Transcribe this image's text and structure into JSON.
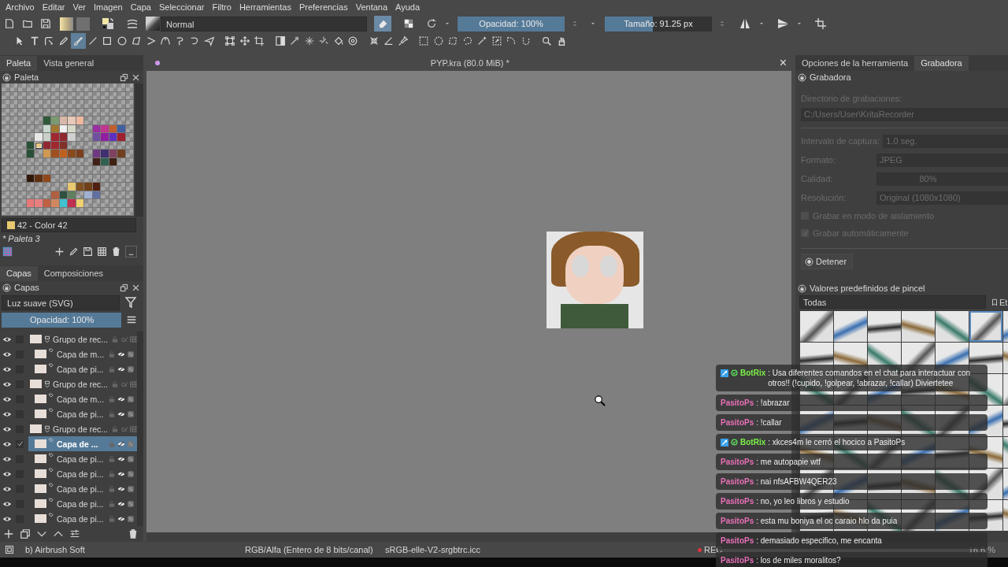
{
  "menu": [
    "Archivo",
    "Editar",
    "Ver",
    "Imagen",
    "Capa",
    "Seleccionar",
    "Filtro",
    "Herramientas",
    "Preferencias",
    "Ventana",
    "Ayuda"
  ],
  "toolbar": {
    "blend_mode": "Normal",
    "eraser_on": true,
    "opacity": {
      "label": "Opacidad: 100%",
      "level": 1
    },
    "size": {
      "label": "Tamaño: 91.25 px",
      "level": 0.45
    }
  },
  "tool_groups": [
    [
      {
        "selected": false
      },
      {
        "selected": false
      },
      {
        "selected": false
      },
      {
        "selected": false
      },
      {
        "selected": true
      },
      {
        "selected": false
      },
      {
        "selected": false
      },
      {
        "selected": false
      },
      {
        "selected": false
      },
      {
        "selected": false
      },
      {
        "selected": false
      },
      {
        "selected": false
      },
      {
        "selected": false
      },
      {
        "selected": false
      }
    ],
    [
      {
        "selected": false
      },
      {
        "selected": false
      },
      {
        "selected": false
      }
    ],
    [
      {
        "selected": false
      },
      {
        "selected": false
      },
      {
        "selected": false
      },
      {
        "selected": false
      },
      {
        "selected": false
      },
      {
        "selected": false
      }
    ],
    [
      {
        "selected": false
      },
      {
        "selected": false
      },
      {
        "selected": false
      }
    ],
    [
      {
        "selected": false
      },
      {
        "selected": false
      },
      {
        "selected": false
      },
      {
        "selected": false
      },
      {
        "selected": false
      },
      {
        "selected": false
      },
      {
        "selected": false
      },
      {
        "selected": false
      }
    ],
    [
      {
        "selected": false
      },
      {
        "selected": false
      }
    ]
  ],
  "left_dock": {
    "tabs": [
      {
        "label": "Paleta",
        "selected": true
      },
      {
        "label": "Vista general",
        "selected": false
      }
    ],
    "title": "Paleta",
    "palette": {
      "rows": [
        [
          null,
          null,
          null,
          null,
          null,
          null,
          null,
          null,
          null,
          null,
          null,
          null,
          null,
          null,
          null,
          null
        ],
        [
          null,
          null,
          null,
          null,
          null,
          null,
          null,
          null,
          null,
          null,
          null,
          null,
          null,
          null,
          null,
          null
        ],
        [
          null,
          null,
          null,
          null,
          null,
          null,
          null,
          null,
          null,
          null,
          null,
          null,
          null,
          null,
          null,
          null
        ],
        [
          null,
          null,
          null,
          null,
          null,
          null,
          null,
          null,
          null,
          null,
          null,
          null,
          null,
          null,
          null,
          null
        ],
        [
          null,
          null,
          null,
          null,
          null,
          {
            "color": "#2f5a3a",
            "selected": false
          },
          {
            "color": "#7a9a70",
            "selected": false
          },
          {
            "color": "#d8b8a8",
            "selected": false
          },
          {
            "color": "#e8c8b8",
            "selected": false
          },
          {
            "color": "#f0b8a0",
            "selected": false
          },
          null,
          null,
          null,
          null,
          null,
          null
        ],
        [
          null,
          null,
          null,
          null,
          null,
          {
            "color": "#c8d8d0",
            "selected": false
          },
          {
            "color": "#a07830",
            "selected": false
          },
          {
            "color": "#f0f0f0",
            "selected": false
          },
          {
            "color": "#d8d8c8",
            "selected": false
          },
          null,
          null,
          {
            "color": "#9a30a0",
            "selected": false
          },
          {
            "color": "#c03890",
            "selected": false
          },
          {
            "color": "#c06030",
            "selected": false
          },
          {
            "color": "#4060a0",
            "selected": false
          },
          null
        ],
        [
          null,
          null,
          null,
          null,
          {
            "color": "#e8e8e8",
            "selected": false
          },
          {
            "color": "#c8d0c8",
            "selected": false
          },
          {
            "color": "#a02830",
            "selected": false
          },
          {
            "color": "#902830",
            "selected": false
          },
          {
            "color": "#d0d0d0",
            "selected": false
          },
          null,
          null,
          {
            "color": "#7050a0",
            "selected": false
          },
          {
            "color": "#9020a0",
            "selected": false
          },
          {
            "color": "#6030c0",
            "selected": false
          },
          {
            "color": "#a02030",
            "selected": false
          },
          null
        ],
        [
          null,
          null,
          null,
          {
            "color": "#2a5038",
            "selected": false
          },
          {
            "color": "#e8c880",
            "selected": true
          },
          {
            "color": "#902830",
            "selected": false
          },
          {
            "color": "#a02830",
            "selected": false
          },
          {
            "color": "#803028",
            "selected": false
          },
          null,
          null,
          null,
          null,
          null,
          null,
          null,
          null
        ],
        [
          null,
          null,
          null,
          {
            "color": "#2a5038",
            "selected": false
          },
          null,
          {
            "color": "#d09850",
            "selected": false
          },
          {
            "color": "#a05020",
            "selected": false
          },
          {
            "color": "#c06020",
            "selected": false
          },
          {
            "color": "#8a4a20",
            "selected": false
          },
          {
            "color": "#7a4020",
            "selected": false
          },
          null,
          {
            "color": "#703880",
            "selected": false
          },
          {
            "color": "#403070",
            "selected": false
          },
          {
            "color": "#804060",
            "selected": false
          },
          {
            "color": "#704020",
            "selected": false
          },
          null
        ],
        [
          null,
          null,
          null,
          null,
          null,
          null,
          null,
          null,
          null,
          null,
          null,
          {
            "color": "#402018",
            "selected": false
          },
          {
            "color": "#306050",
            "selected": false
          },
          {
            "color": "#402010",
            "selected": false
          },
          null,
          null
        ],
        [
          null,
          null,
          null,
          null,
          null,
          null,
          null,
          null,
          null,
          null,
          null,
          null,
          null,
          null,
          null,
          null
        ],
        [
          null,
          null,
          null,
          {
            "color": "#301808",
            "selected": false
          },
          {
            "color": "#603010",
            "selected": false
          },
          {
            "color": "#904818",
            "selected": false
          },
          null,
          null,
          null,
          null,
          null,
          null,
          null,
          null,
          null,
          null
        ],
        [
          null,
          null,
          null,
          null,
          null,
          null,
          null,
          null,
          {
            "color": "#e8c870",
            "selected": false
          },
          {
            "color": "#805020",
            "selected": false
          },
          {
            "color": "#704018",
            "selected": false
          },
          {
            "color": "#502010",
            "selected": false
          },
          null,
          null,
          null,
          null
        ],
        [
          null,
          null,
          null,
          null,
          null,
          null,
          {
            "color": "#b06040",
            "selected": false
          },
          {
            "color": "#305040",
            "selected": false
          },
          {
            "color": "#608060",
            "selected": false
          },
          null,
          {
            "color": "#a0b0d0",
            "selected": false
          },
          {
            "color": "#6070a0",
            "selected": false
          },
          null,
          null,
          null,
          null
        ],
        [
          null,
          null,
          null,
          {
            "color": "#e87878",
            "selected": false
          },
          {
            "color": "#e88080",
            "selected": false
          },
          {
            "color": "#c06040",
            "selected": false
          },
          {
            "color": "#d08860",
            "selected": false
          },
          {
            "color": "#40c0d0",
            "selected": false
          },
          {
            "color": "#c03050",
            "selected": false
          },
          {
            "color": "#f0d070",
            "selected": false
          },
          null,
          null,
          null,
          null,
          null,
          null
        ],
        [
          null,
          null,
          null,
          null,
          null,
          null,
          null,
          null,
          null,
          null,
          null,
          null,
          null,
          null,
          null,
          null
        ]
      ],
      "current_color": {
        "label": "42 - Color 42",
        "color": "#e8c870"
      },
      "name": "* Paleta 3"
    },
    "layer_tabs": [
      {
        "label": "Capas",
        "selected": true
      },
      {
        "label": "Composiciones",
        "selected": false
      }
    ],
    "layers_title": "Capas",
    "layer_blend": "Luz suave (SVG)",
    "layer_opacity": {
      "label": "Opacidad:  100%",
      "level": 1
    },
    "layers": [
      {
        "name": "Grupo de rec...",
        "kind": "group",
        "visible": true,
        "checked": false,
        "selected": false,
        "children": [
          {
            "name": "Capa de m...",
            "kind": "layer",
            "visible": true,
            "checked": false,
            "selected": false
          },
          {
            "name": "Capa de pi...",
            "kind": "layer",
            "visible": true,
            "checked": false,
            "selected": false
          }
        ]
      },
      {
        "name": "Grupo de rec...",
        "kind": "group",
        "visible": true,
        "checked": false,
        "selected": false,
        "children": [
          {
            "name": "Capa de m...",
            "kind": "layer",
            "visible": true,
            "checked": false,
            "selected": false
          },
          {
            "name": "Capa de pi...",
            "kind": "layer",
            "visible": true,
            "checked": false,
            "selected": false
          }
        ]
      },
      {
        "name": "Grupo de rec...",
        "kind": "group",
        "visible": true,
        "checked": false,
        "selected": false,
        "children": [
          {
            "name": "Capa de ...",
            "kind": "layer",
            "visible": true,
            "checked": true,
            "selected": true
          },
          {
            "name": "Capa de pi...",
            "kind": "layer",
            "visible": true,
            "checked": false,
            "selected": false
          },
          {
            "name": "Capa de pi...",
            "kind": "layer",
            "visible": true,
            "checked": false,
            "selected": false
          },
          {
            "name": "Capa de pi...",
            "kind": "layer",
            "visible": true,
            "checked": false,
            "selected": false
          },
          {
            "name": "Capa de pi...",
            "kind": "layer",
            "visible": true,
            "checked": false,
            "selected": false
          },
          {
            "name": "Capa de pi...",
            "kind": "layer",
            "visible": true,
            "checked": false,
            "selected": false
          }
        ]
      }
    ]
  },
  "document": {
    "title": "PYP.kra (80.0 MiB) *",
    "close": "×"
  },
  "right_dock": {
    "tabs": [
      {
        "label": "Opciones de la herramienta",
        "selected": false
      },
      {
        "label": "Grabadora",
        "selected": true
      }
    ],
    "recorder": {
      "title": "Grabadora",
      "disabled": true,
      "directory_label": "Directorio de grabaciones:",
      "directory": "C:/Users/User\\KritaRecorder",
      "fields": [
        {
          "label": "Intervalo de captura:",
          "value": "1.0 seg.",
          "kind": "spin"
        },
        {
          "label": "Formato:",
          "value": "JPEG",
          "kind": "combo"
        },
        {
          "label": "Calidad:",
          "value": "80%",
          "kind": "slider"
        },
        {
          "label": "Resolución:",
          "value": "Original (1080x1080)",
          "kind": "combo"
        }
      ],
      "options": [
        {
          "label": "Grabar en modo de aislamiento",
          "checked": false
        },
        {
          "label": "Grabar automáticamente",
          "checked": true
        }
      ],
      "stop_button": "Detener"
    },
    "presets_title": "Valores predefinidos de pincel",
    "preset_filter": "Todas",
    "tag_button": "Et",
    "brush_presets": [
      {
        "selected": false
      },
      {
        "selected": false
      },
      {
        "selected": false
      },
      {
        "selected": false
      },
      {
        "selected": false
      },
      {
        "selected": true
      },
      {
        "selected": false
      },
      {
        "selected": false
      },
      {
        "selected": false
      },
      {
        "selected": false
      },
      {
        "selected": false
      },
      {
        "selected": false
      },
      {
        "selected": false
      },
      {
        "selected": false
      },
      {
        "selected": false
      },
      {
        "selected": false
      },
      {
        "selected": false
      },
      {
        "selected": false
      },
      {
        "selected": false
      },
      {
        "selected": false
      },
      {
        "selected": false
      },
      {
        "selected": false
      },
      {
        "selected": false
      },
      {
        "selected": false
      },
      {
        "selected": false
      },
      {
        "selected": false
      },
      {
        "selected": false
      },
      {
        "selected": false
      },
      {
        "selected": false
      },
      {
        "selected": false
      },
      {
        "selected": false
      },
      {
        "selected": false
      },
      {
        "selected": false
      },
      {
        "selected": false
      },
      {
        "selected": false
      },
      {
        "selected": false
      },
      {
        "selected": false
      },
      {
        "selected": false
      },
      {
        "selected": false
      },
      {
        "selected": false
      },
      {
        "selected": false
      },
      {
        "selected": false
      },
      {
        "selected": false
      },
      {
        "selected": false
      },
      {
        "selected": false
      },
      {
        "selected": false
      },
      {
        "selected": false
      },
      {
        "selected": false
      },
      {
        "selected": false
      }
    ]
  },
  "status_bar": {
    "brush": "b) Airbrush Soft",
    "color_model": "RGB/Alfa (Entero de 8 bits/canal)",
    "profile": "sRGB-elle-V2-srgbtrc.icc",
    "recording": "REC",
    "zoom": "16.6 %"
  },
  "chat": [
    {
      "user": "BotRix",
      "color": "#7cf04a",
      "badges": true,
      "text": ": Usa diferentes comandos en el chat para interactuar con otros!! (!cupido, !golpear, !abrazar, !callar) Diviertetee"
    },
    {
      "user": "PasitoPs",
      "color": "#e870b8",
      "badges": false,
      "text": ": !abrazar"
    },
    {
      "user": "PasitoPs",
      "color": "#e870b8",
      "badges": false,
      "text": ": !callar"
    },
    {
      "user": "BotRix",
      "color": "#7cf04a",
      "badges": true,
      "text": ": xkces4m le cerró el hocico a PasitoPs"
    },
    {
      "user": "PasitoPs",
      "color": "#e870b8",
      "badges": false,
      "text": ": me autopapie wtf"
    },
    {
      "user": "PasitoPs",
      "color": "#e870b8",
      "badges": false,
      "text": ": nai nfsAFBW4QER23"
    },
    {
      "user": "PasitoPs",
      "color": "#e870b8",
      "badges": false,
      "text": ": no, yo leo libros y estudio"
    },
    {
      "user": "PasitoPs",
      "color": "#e870b8",
      "badges": false,
      "text": ": esta mu boniya el oc caraio hlo da puia"
    },
    {
      "user": "PasitoPs",
      "color": "#e870b8",
      "badges": false,
      "text": ": demasiado especifico, me encanta"
    },
    {
      "user": "PasitoPs",
      "color": "#e870b8",
      "badges": false,
      "text": ": los de miles moralitos?"
    }
  ]
}
